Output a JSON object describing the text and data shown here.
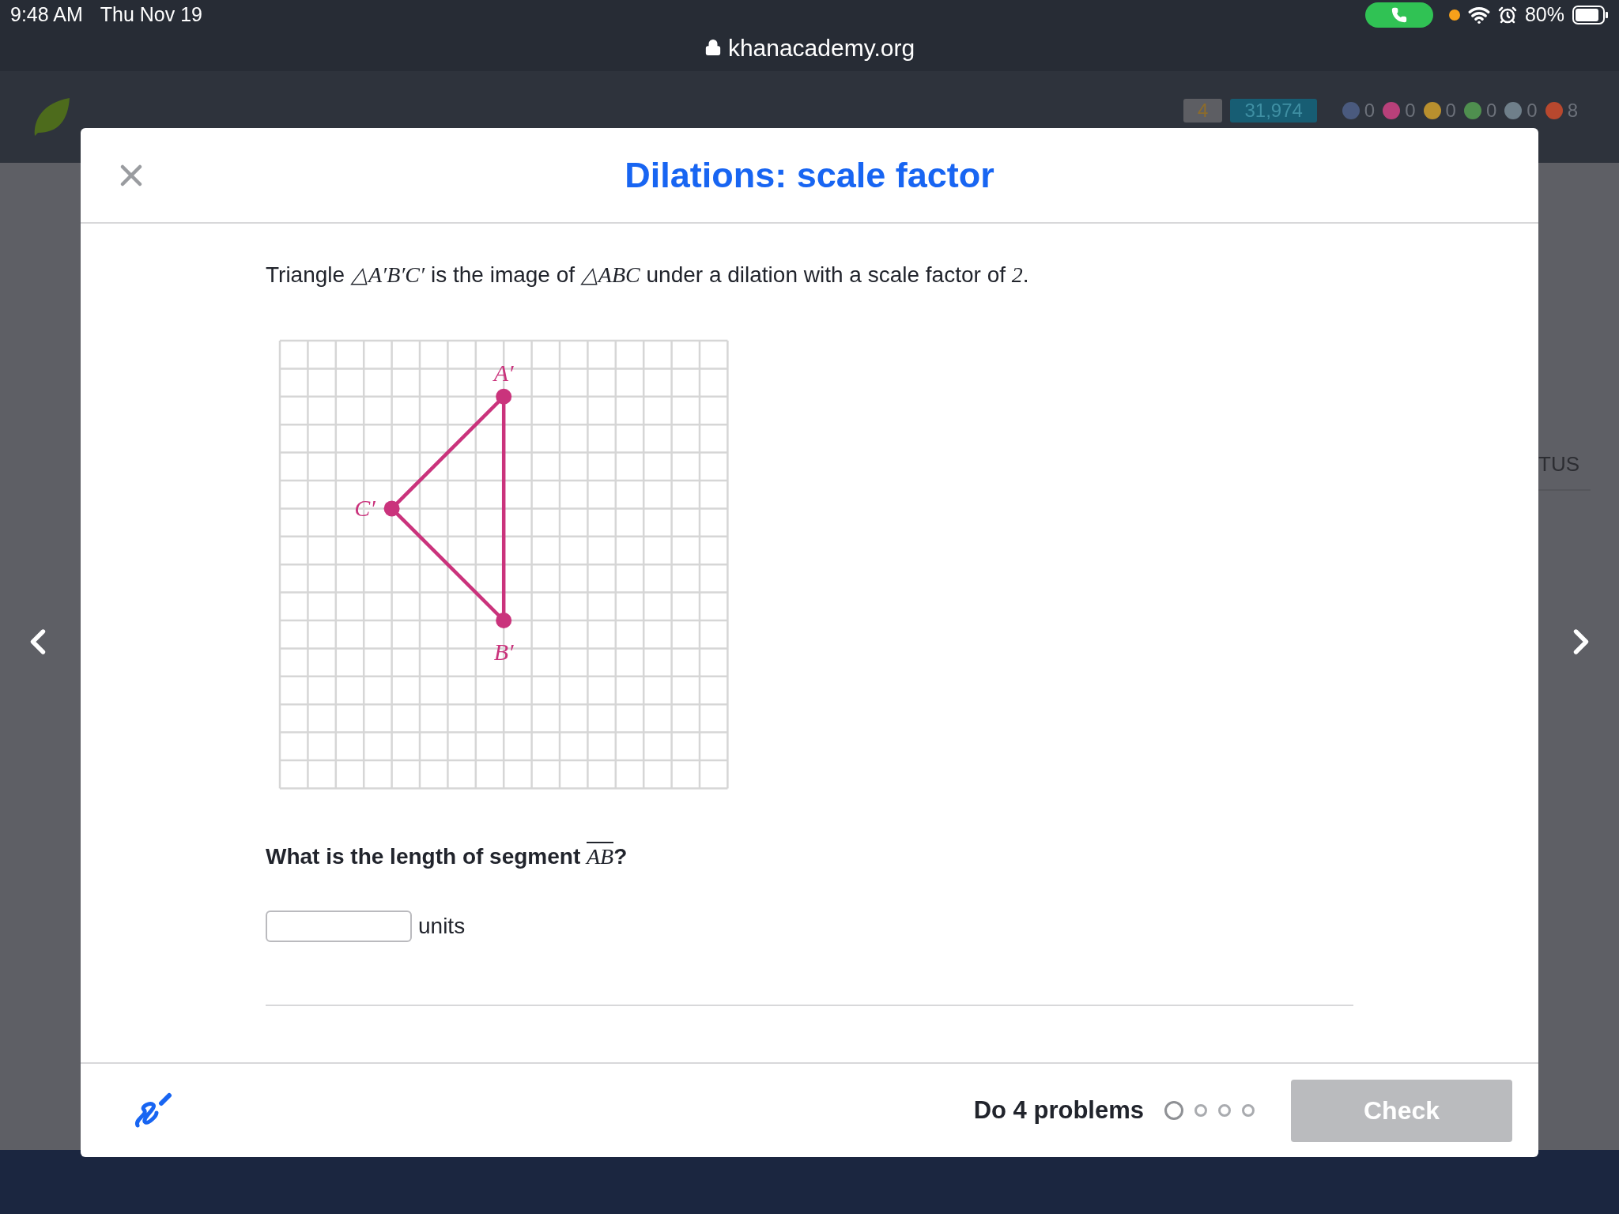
{
  "status_bar": {
    "time": "9:48 AM",
    "date": "Thu Nov 19",
    "battery": "80%"
  },
  "browser": {
    "url": "khanacademy.org"
  },
  "site_header": {
    "streak": "4",
    "points": "31,974",
    "badges": [
      {
        "count": "0",
        "color": "#4a5a7e"
      },
      {
        "count": "0",
        "color": "#b8407a"
      },
      {
        "count": "0",
        "color": "#b88f2e"
      },
      {
        "count": "0",
        "color": "#4f8f4f"
      },
      {
        "count": "0",
        "color": "#6f7f8a"
      },
      {
        "count": "8",
        "color": "#b8482e"
      }
    ]
  },
  "background_page": {
    "text": "TUS"
  },
  "modal": {
    "title": "Dilations: scale factor",
    "prompt": [
      {
        "kind": "text",
        "text": "Triangle "
      },
      {
        "kind": "math",
        "text": "△A′B′C′"
      },
      {
        "kind": "text",
        "text": " is the image of "
      },
      {
        "kind": "math",
        "text": "△ABC"
      },
      {
        "kind": "text",
        "text": " under a dilation with a scale factor of "
      },
      {
        "kind": "math",
        "text": "2"
      },
      {
        "kind": "text",
        "text": "."
      }
    ],
    "graph": {
      "vertices": [
        {
          "label": "A′"
        },
        {
          "label": "B′"
        },
        {
          "label": "C′"
        }
      ]
    },
    "question": [
      {
        "kind": "text",
        "text": "What is the length of segment "
      },
      {
        "kind": "overline",
        "text": "AB"
      },
      {
        "kind": "text",
        "text": "?"
      }
    ],
    "answer": {
      "unit": "units"
    },
    "footer": {
      "goal": "Do 4 problems",
      "problems": [
        {
          "current": true
        },
        {
          "current": false
        },
        {
          "current": false
        },
        {
          "current": false
        }
      ],
      "check": {
        "label": "Check",
        "disabled": true
      }
    }
  }
}
